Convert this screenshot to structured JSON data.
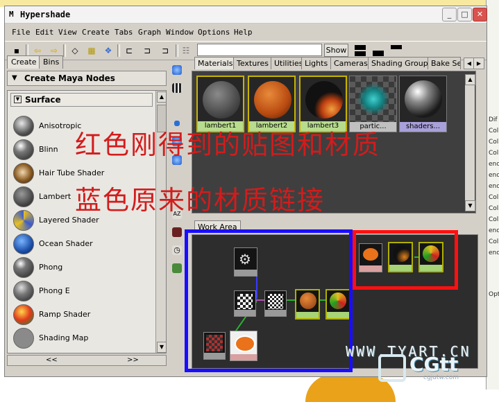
{
  "window": {
    "title": "Hypershade",
    "controls": [
      "_",
      "□",
      "✕"
    ]
  },
  "menu": [
    "File",
    "Edit",
    "View",
    "Create",
    "Tabs",
    "Graph",
    "Window",
    "Options",
    "Help"
  ],
  "toolbar": {
    "search_value": "",
    "show_label": "Show"
  },
  "left_panel": {
    "tabs": [
      "Create",
      "Bins"
    ],
    "header": "Create Maya Nodes",
    "section": "Surface",
    "nodes": [
      "Anisotropic",
      "Blinn",
      "Hair Tube Shader",
      "Lambert",
      "Layered Shader",
      "Ocean Shader",
      "Phong",
      "Phong E",
      "Ramp Shader",
      "Shading Map"
    ],
    "nav": [
      "<<",
      ">>"
    ]
  },
  "right_panel": {
    "tabs": [
      "Materials",
      "Textures",
      "Utilities",
      "Lights",
      "Cameras",
      "Shading Groups",
      "Bake Se"
    ],
    "swatches": [
      "lambert1",
      "lambert2",
      "lambert3",
      "partic...",
      "shaders..."
    ],
    "work_area_tab": "Work Area"
  },
  "annotations": {
    "line1": "红色刚得到的贴图和材质",
    "line2": "蓝色原来的材质链接"
  },
  "watermark": {
    "site": "WWW.TYART.CN",
    "brand": "CGtt",
    "url": "cgjutw.com"
  },
  "colors": {
    "annotation_red": "#d21c1c",
    "blue_outline": "#1a0dff",
    "red_outline": "#ff1010"
  }
}
